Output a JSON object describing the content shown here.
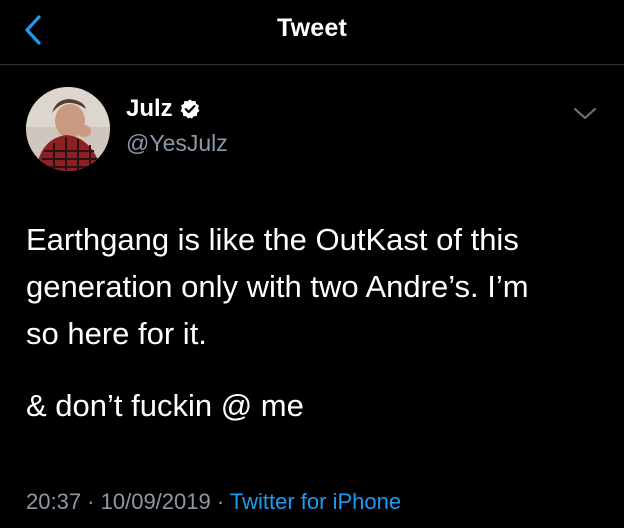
{
  "nav": {
    "title": "Tweet"
  },
  "author": {
    "display_name": "Julz",
    "handle": "@YesJulz",
    "verified": true
  },
  "tweet": {
    "lines": [
      "Earthgang is like the OutKast of this",
      "generation only with two Andre’s. I’m",
      "so here for it.",
      "& don’t fuckin @ me"
    ],
    "time": "20:37",
    "separator1": " · ",
    "date": "10/09/2019",
    "separator2": " · ",
    "source": "Twitter for iPhone"
  },
  "icons": {
    "back": "chevron-left-icon",
    "verified": "verified-badge-icon",
    "more": "chevron-down-icon"
  },
  "colors": {
    "background": "#000000",
    "accent": "#1d9bf0",
    "secondary_text": "#8b98a5",
    "divider": "#2f3336"
  }
}
